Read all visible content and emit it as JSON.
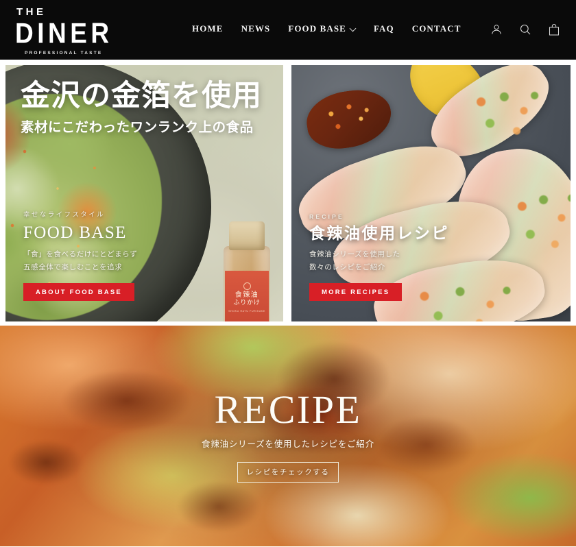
{
  "header": {
    "logo": {
      "the": "THE",
      "name": "DINER",
      "tagline": "PROFESSIONAL TASTE"
    },
    "nav": [
      {
        "label": "HOME",
        "has_dropdown": false
      },
      {
        "label": "NEWS",
        "has_dropdown": false
      },
      {
        "label": "FOOD BASE",
        "has_dropdown": true
      },
      {
        "label": "FAQ",
        "has_dropdown": false
      },
      {
        "label": "CONTACT",
        "has_dropdown": false
      }
    ],
    "icons": [
      {
        "name": "account-icon"
      },
      {
        "name": "search-icon"
      },
      {
        "name": "cart-icon"
      }
    ]
  },
  "hero": {
    "left_card": {
      "headline": "金沢の金箔を使用",
      "subheadline": "素材にこだわったワンランク上の食品",
      "eyebrow": "幸せなライフスタイル",
      "title": "FOOD BASE",
      "desc_line1": "「食」を食べるだけにとどまらず",
      "desc_line2": "五感全体で楽しむことを追求",
      "button": "ABOUT FOOD BASE",
      "product_label_line1": "食辣油",
      "product_label_line2": "ふりかけ",
      "product_label_sub": "SHOKU RAYU FURIKAKE"
    },
    "right_card": {
      "eyebrow": "RECIPE",
      "title": "食辣油使用レシピ",
      "desc_line1": "食辣油シリーズを使用した",
      "desc_line2": "数々のレシピをご紹介",
      "button": "MORE RECIPES"
    }
  },
  "banner": {
    "title": "RECIPE",
    "subtitle": "食辣油シリーズを使用したレシピをご紹介",
    "button": "レシピをチェックする"
  },
  "colors": {
    "header_bg": "#0a0a0a",
    "accent_red": "#d81f26",
    "text_light": "#ffffff",
    "page_bg": "#ffffff",
    "outline_button_border": "#efe9d8"
  }
}
